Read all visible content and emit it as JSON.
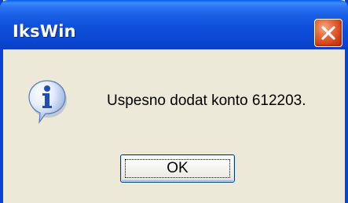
{
  "window": {
    "title": "IksWin"
  },
  "dialog": {
    "icon": "information-icon",
    "message": "Uspesno dodat konto 612203."
  },
  "buttons": {
    "ok_label": "OK",
    "close_icon": "close-icon"
  },
  "colors": {
    "titlebar": "#0b48d4",
    "dialog_background": "#ece9d8",
    "close_button": "#d9491c"
  }
}
